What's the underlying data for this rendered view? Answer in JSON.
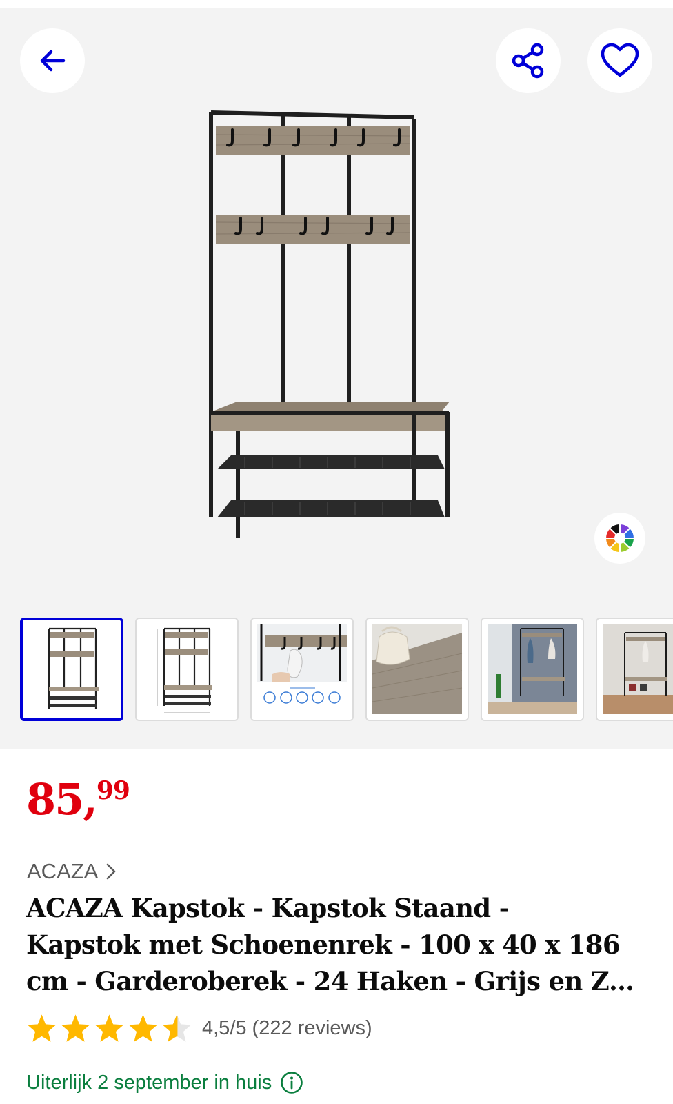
{
  "header": {
    "back_icon": "arrow-left-icon",
    "share_icon": "share-icon",
    "favorite_icon": "heart-icon",
    "accent_color": "#0000d8"
  },
  "gallery": {
    "color_picker_icon": "color-wheel-icon",
    "thumbnails": [
      {
        "label": "hall-tree-front"
      },
      {
        "label": "hall-tree-dimensions"
      },
      {
        "label": "hooks-closeup"
      },
      {
        "label": "bench-wood-closeup"
      },
      {
        "label": "hall-tree-in-hallway"
      },
      {
        "label": "hall-tree-room"
      }
    ],
    "active_thumbnail": 0
  },
  "product": {
    "price_euros": "85,",
    "price_cents": "99",
    "price_color": "#e0000e",
    "brand": "ACAZA",
    "title_lines": [
      "ACAZA Kapstok - Kapstok Staand -",
      "Kapstok met Schoenenrek - 100 x 40 x 186",
      "cm - Garderoberek - 24 Haken - Grijs en Z…"
    ],
    "rating": 4.5,
    "rating_text": "4,5/5 (222 reviews)",
    "star_color": "#ffb800",
    "delivery_text": "Uiterlijk 2 september in huis",
    "delivery_color": "#0a7e3e",
    "delivery_icon": "info-icon"
  }
}
